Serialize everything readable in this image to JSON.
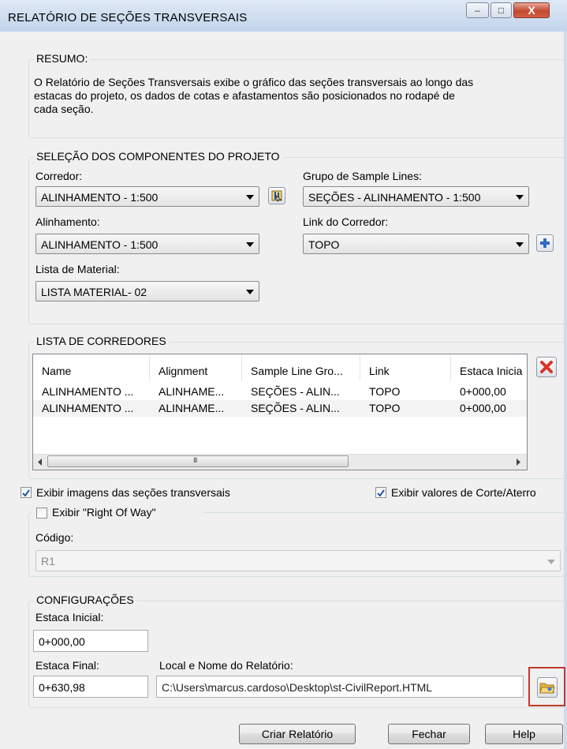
{
  "window": {
    "title": "RELATÓRIO DE SEÇÕES TRANSVERSAIS",
    "minimize": "–",
    "maximize": "□",
    "close": "X"
  },
  "resumo": {
    "legend": "RESUMO:",
    "lines": [
      "O Relatório de Seções Transversais exibe o gráfico das seções transversais ao longo das",
      "estacas do projeto, os dados de cotas e afastamentos são posicionados no rodapé de",
      "cada seção."
    ]
  },
  "selecao": {
    "legend": "SELEÇÃO DOS COMPONENTES DO PROJETO",
    "corredor_label": "Corredor:",
    "corredor_value": "ALINHAMENTO - 1:500",
    "grupo_label": "Grupo de Sample Lines:",
    "grupo_value": "SEÇÕES - ALINHAMENTO - 1:500",
    "alinhamento_label": "Alinhamento:",
    "alinhamento_value": "ALINHAMENTO - 1:500",
    "link_label": "Link do Corredor:",
    "link_value": "TOPO",
    "material_label": "Lista de Material:",
    "material_value": "LISTA MATERIAL- 02"
  },
  "lista": {
    "legend": "LISTA DE CORREDORES",
    "columns": [
      "Name",
      "Alignment",
      "Sample Line Gro...",
      "Link",
      "Estaca Inicia"
    ],
    "rows": [
      [
        "ALINHAMENTO ...",
        "ALINHAME...",
        "SEÇÕES - ALIN...",
        "TOPO",
        "0+000,00"
      ],
      [
        "ALINHAMENTO ...",
        "ALINHAME...",
        "SEÇÕES - ALIN...",
        "TOPO",
        "0+000,00"
      ]
    ],
    "scroll_grip": "III"
  },
  "options": {
    "exibir_imagens": "Exibir imagens das seções transversais",
    "exibir_imagens_checked": true,
    "exibir_corte": "Exibir valores de Corte/Aterro",
    "exibir_corte_checked": true,
    "right_of_way": "Exibir \"Right Of Way\"",
    "right_of_way_checked": false,
    "codigo_label": "Código:",
    "codigo_value": "R1"
  },
  "config": {
    "legend": "CONFIGURAÇÕES",
    "estaca_inicial_label": "Estaca Inicial:",
    "estaca_inicial_value": "0+000,00",
    "estaca_final_label": "Estaca Final:",
    "estaca_final_value": "0+630,98",
    "local_label": "Local e Nome do Relatório:",
    "local_value": "C:\\Users\\marcus.cardoso\\Desktop\\st-CivilReport.HTML"
  },
  "buttons": {
    "criar": "Criar Relatório",
    "fechar": "Fechar",
    "help": "Help"
  },
  "colors": {
    "highlight_box": "#c0392b",
    "delete_icon": "#d9352a",
    "add_icon": "#2e6cc4",
    "checkbox_check": "#1f56a8"
  }
}
